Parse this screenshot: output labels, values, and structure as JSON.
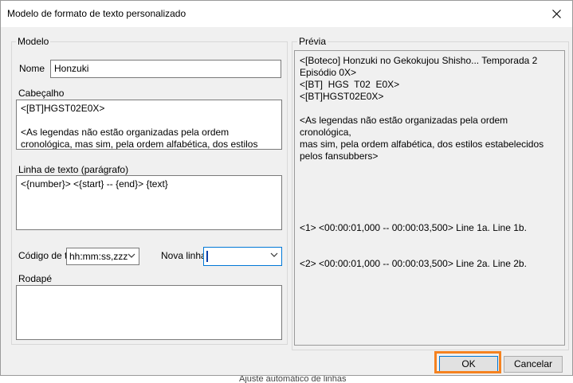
{
  "dialog": {
    "title": "Modelo de formato de texto personalizado"
  },
  "model_group": {
    "label": "Modelo",
    "name_label": "Nome",
    "name_value": "Honzuki",
    "header_label": "Cabeçalho",
    "header_value": "<[BT]HGST02E0X>\n\n<As legendas não estão organizadas pela ordem\ncronológica, mas sim, pela ordem alfabética, dos estilos",
    "line_label": "Linha de texto (parágrafo)",
    "line_value": "<{number}> <{start} -- {end}> {text}",
    "timecode_label": "Código de t",
    "timecode_value": "hh:mm:ss,zzz",
    "newline_label": "Nova linha",
    "newline_value": "",
    "footer_label": "Rodapé",
    "footer_value": ""
  },
  "preview_group": {
    "label": "Prévia",
    "text": "<[Boteco] Honzuki no Gekokujou Shisho... Temporada 2\nEpisódio 0X>\n<[BT]  HGS  T02  E0X>\n<[BT]HGST02E0X>\n\n<As legendas não estão organizadas pela ordem cronológica,\nmas sim, pela ordem alfabética, dos estilos estabelecidos\npelos fansubbers>\n\n\n\n\n\n<1> <00:00:01,000 -- 00:00:03,500> Line 1a. Line 1b.\n\n\n<2> <00:00:01,000 -- 00:00:03,500> Line 2a. Line 2b."
  },
  "buttons": {
    "ok": "OK",
    "cancel": "Cancelar"
  },
  "background": {
    "bottom_text": "Ajuste automático de linhas"
  },
  "colors": {
    "highlight": "#f58220",
    "focus": "#0078d7"
  }
}
